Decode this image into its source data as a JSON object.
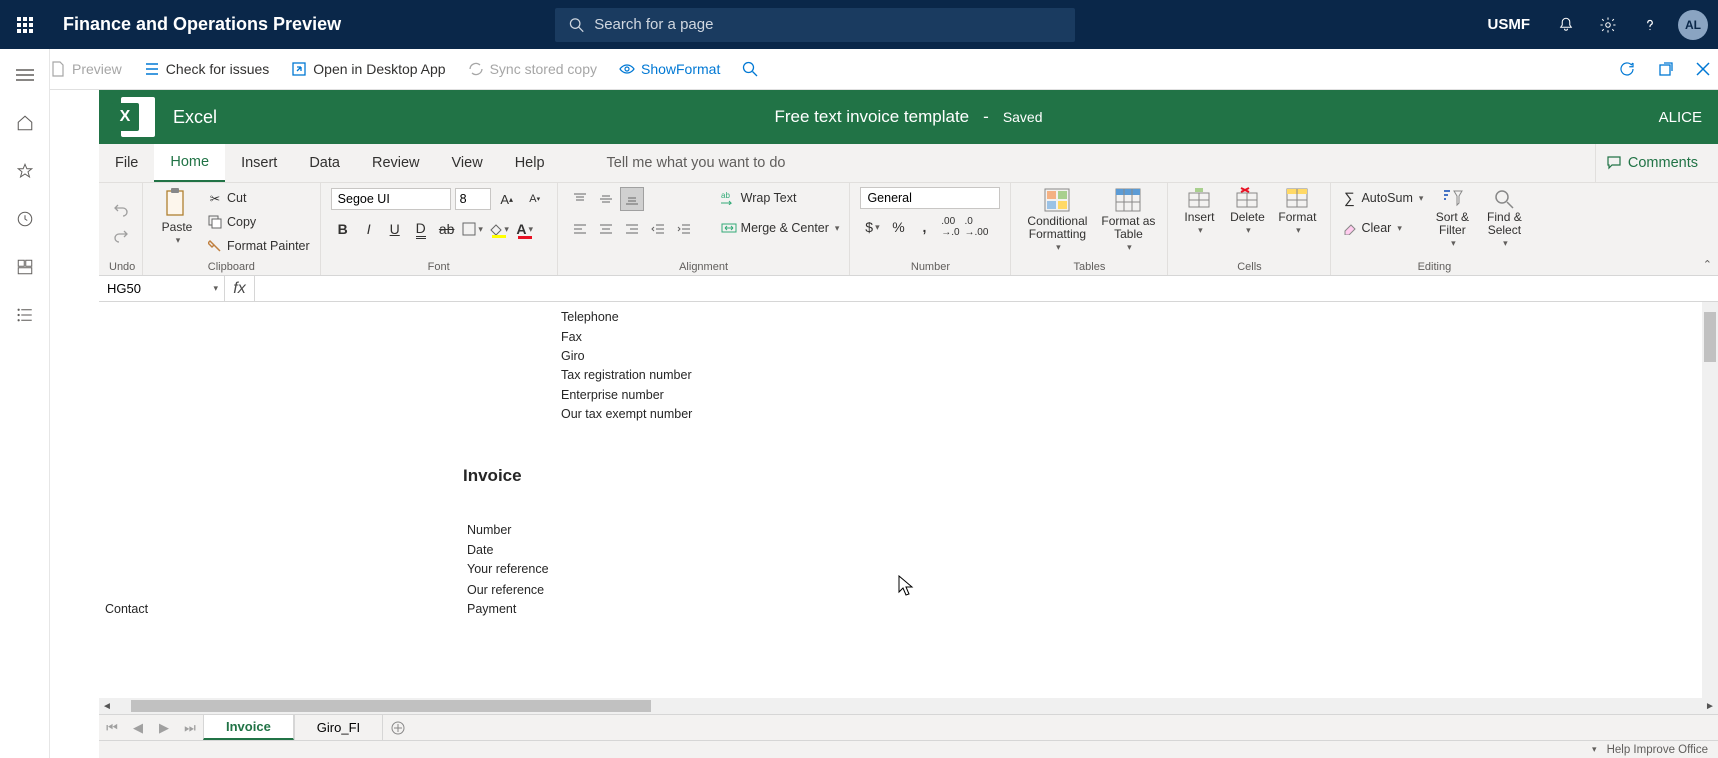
{
  "dynamics": {
    "title": "Finance and Operations Preview",
    "search_placeholder": "Search for a page",
    "entity": "USMF",
    "avatar": "AL"
  },
  "commandbar": {
    "preview": "Preview",
    "check": "Check for issues",
    "open_desktop": "Open in Desktop App",
    "sync": "Sync stored copy",
    "show_format": "ShowFormat"
  },
  "excel": {
    "app": "Excel",
    "doc_name": "Free text invoice template",
    "dash": "-",
    "saved": "Saved",
    "user": "ALICE"
  },
  "tabs": {
    "file": "File",
    "home": "Home",
    "insert": "Insert",
    "data": "Data",
    "review": "Review",
    "view": "View",
    "help": "Help",
    "tellme": "Tell me what you want to do",
    "comments": "Comments"
  },
  "ribbon": {
    "undo_group": "Undo",
    "clipboard": {
      "paste": "Paste",
      "cut": "Cut",
      "copy": "Copy",
      "format_painter": "Format Painter",
      "label": "Clipboard"
    },
    "font": {
      "name": "Segoe UI",
      "size": "8",
      "label": "Font"
    },
    "alignment": {
      "wrap": "Wrap Text",
      "merge": "Merge & Center",
      "label": "Alignment"
    },
    "number": {
      "format": "General",
      "label": "Number"
    },
    "tables": {
      "cond": "Conditional Formatting",
      "as_table": "Format as Table",
      "label": "Tables"
    },
    "cells": {
      "insert": "Insert",
      "delete": "Delete",
      "format": "Format",
      "label": "Cells"
    },
    "editing": {
      "autosum": "AutoSum",
      "clear": "Clear",
      "sort": "Sort & Filter",
      "find": "Find & Select",
      "label": "Editing"
    }
  },
  "namebox": "HG50",
  "formula": "",
  "sheet": {
    "telephone": "Telephone",
    "fax": "Fax",
    "giro": "Giro",
    "tax_reg": "Tax registration number",
    "enterprise": "Enterprise number",
    "tax_exempt": "Our tax exempt number",
    "invoice": "Invoice",
    "number": "Number",
    "date": "Date",
    "your_ref": "Your reference",
    "our_ref": "Our reference",
    "payment": "Payment",
    "contact": "Contact"
  },
  "sheet_tabs": {
    "t1": "Invoice",
    "t2": "Giro_FI"
  },
  "status": {
    "help": "Help Improve Office"
  }
}
